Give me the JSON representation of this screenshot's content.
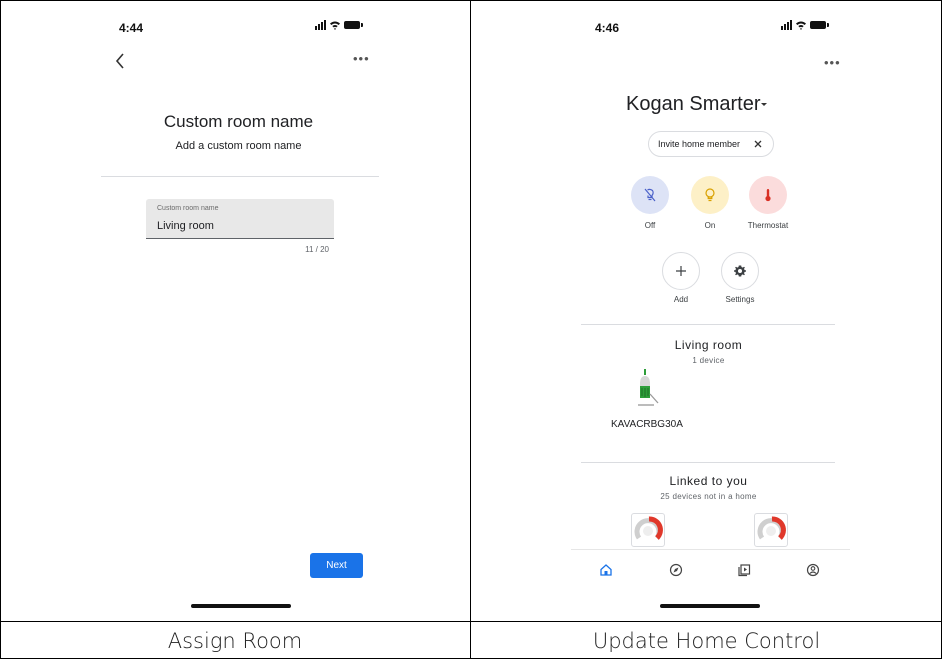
{
  "captions": {
    "left": "Assign Room",
    "right": "Update Home Control"
  },
  "assign_room": {
    "status_time": "4:44",
    "more_icon": "more-horiz-icon",
    "back_icon": "chevron-left-icon",
    "title": "Custom room name",
    "subtitle": "Add a custom room name",
    "field_label": "Custom room name",
    "field_value": "Living room",
    "counter": "11 / 20",
    "next_label": "Next",
    "accent": "#1a73e8"
  },
  "home_control": {
    "status_time": "4:46",
    "home_name": "Kogan Smarter",
    "invite_chip": "Invite home member",
    "quick_actions": [
      {
        "label": "Off",
        "icon": "light-off-icon",
        "bg": "#dde3f6",
        "fg": "#4a60c9"
      },
      {
        "label": "On",
        "icon": "lightbulb-icon",
        "bg": "#fdf0c7",
        "fg": "#d9a100"
      },
      {
        "label": "Thermostat",
        "icon": "thermometer-icon",
        "bg": "#fbdcdc",
        "fg": "#d93025"
      }
    ],
    "add_label": "Add",
    "settings_label": "Settings",
    "room": {
      "title": "Living room",
      "subtitle": "1 device",
      "device_name": "KAVACRBG30A"
    },
    "linked": {
      "title": "Linked to you",
      "subtitle": "25 devices not in a home"
    },
    "nav_icons": [
      "home-icon",
      "explore-icon",
      "media-icon",
      "account-icon"
    ],
    "active_nav_color": "#1a73e8"
  }
}
